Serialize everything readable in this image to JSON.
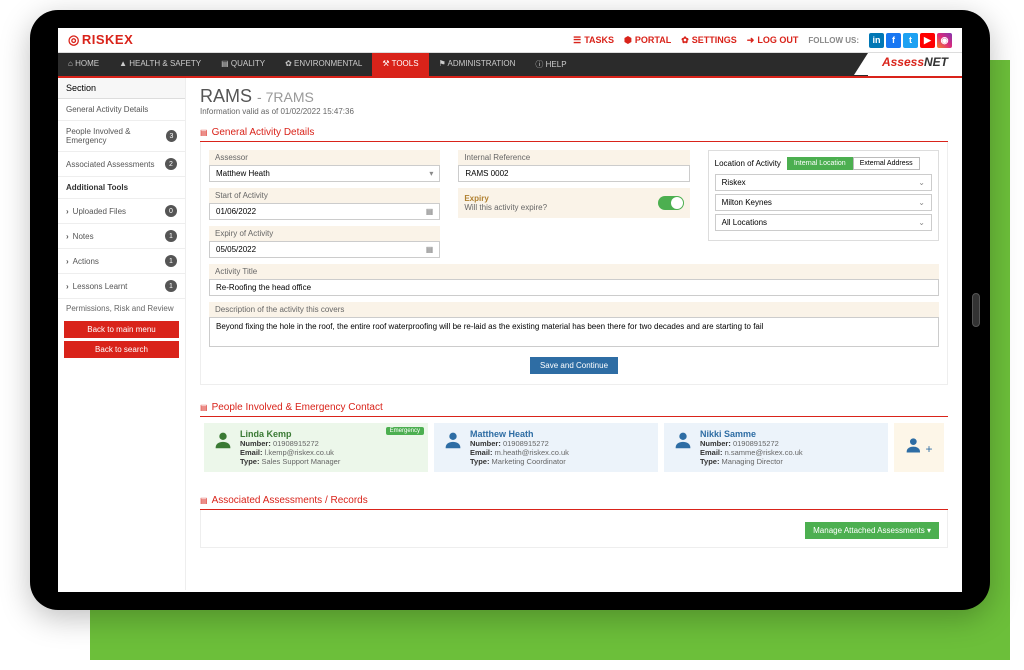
{
  "brand": "RISKEX",
  "secondaryBrand": {
    "prefix": "Assess",
    "suffix": "NET"
  },
  "topNav": {
    "tasks": "TASKS",
    "portal": "PORTAL",
    "settings": "SETTINGS",
    "logout": "LOG OUT",
    "follow": "FOLLOW US:"
  },
  "mainNav": {
    "home": "HOME",
    "health": "HEALTH & SAFETY",
    "quality": "QUALITY",
    "env": "ENVIRONMENTAL",
    "tools": "TOOLS",
    "admin": "ADMINISTRATION",
    "help": "HELP"
  },
  "sidebar": {
    "title": "Section",
    "items": [
      {
        "label": "General Activity Details"
      },
      {
        "label": "People Involved & Emergency",
        "badge": "3"
      },
      {
        "label": "Associated Assessments",
        "badge": "2"
      },
      {
        "label": "Additional Tools",
        "bold": true
      },
      {
        "label": "Uploaded Files",
        "badge": "0",
        "sub": true
      },
      {
        "label": "Notes",
        "badge": "1",
        "sub": true
      },
      {
        "label": "Actions",
        "badge": "1",
        "sub": true
      },
      {
        "label": "Lessons Learnt",
        "badge": "1",
        "sub": true
      }
    ],
    "perm": "Permissions, Risk and Review",
    "back1": "Back to main menu",
    "back2": "Back to search"
  },
  "page": {
    "title": "RAMS",
    "subtitle": "- 7RAMS",
    "info": "Information valid as of 01/02/2022 15:47:36"
  },
  "panels": {
    "general": "General Activity Details",
    "people": "People Involved & Emergency Contact",
    "assoc": "Associated Assessments / Records"
  },
  "form": {
    "assessor": {
      "label": "Assessor",
      "value": "Matthew Heath"
    },
    "start": {
      "label": "Start of Activity",
      "value": "01/06/2022"
    },
    "expiryDate": {
      "label": "Expiry of Activity",
      "value": "05/05/2022"
    },
    "ref": {
      "label": "Internal Reference",
      "value": "RAMS 0002"
    },
    "expiry": {
      "label": "Expiry",
      "hint": "Will this activity expire?"
    },
    "loc": {
      "label": "Location of Activity",
      "internal": "Internal Location",
      "external": "External Address",
      "v1": "Riskex",
      "v2": "Milton Keynes",
      "v3": "All Locations"
    },
    "title": {
      "label": "Activity Title",
      "value": "Re-Roofing the head office"
    },
    "desc": {
      "label": "Description of the activity this covers",
      "value": "Beyond fixing the hole in the roof, the entire roof waterproofing will be re-laid as the existing material has been there for two decades and are starting to fail"
    },
    "save": "Save and Continue"
  },
  "people": [
    {
      "name": "Linda  Kemp",
      "number": "01908915272",
      "email": "l.kemp@riskex.co.uk",
      "type": "Sales Support Manager",
      "emergency": "Emergency",
      "green": true
    },
    {
      "name": "Matthew Heath",
      "number": "01908915272",
      "email": "m.heath@riskex.co.uk",
      "type": "Marketing Coordinator"
    },
    {
      "name": "Nikki Samme",
      "number": "01908915272",
      "email": "n.samme@riskex.co.uk",
      "type": "Managing Director"
    }
  ],
  "labels": {
    "number": "Number:",
    "email": "Email:",
    "type": "Type:"
  },
  "assoc": {
    "manage": "Manage Attached Assessments"
  }
}
